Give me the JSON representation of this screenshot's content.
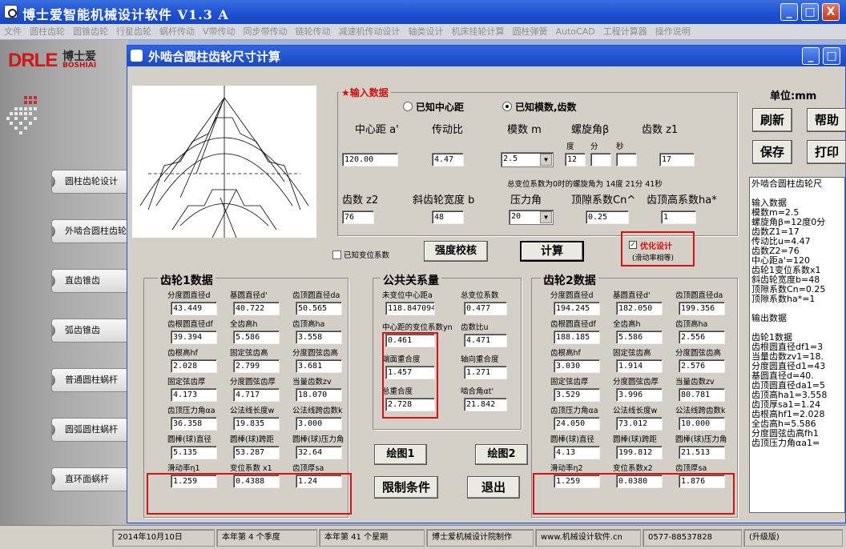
{
  "app": {
    "title": "博士爱智能机械设计软件 V1.3 A",
    "win_min": "_",
    "win_max": "□",
    "win_close": "X"
  },
  "menu": [
    "文件",
    "圆柱齿轮",
    "圆锥齿轮",
    "行星齿轮",
    "蜗杆传动",
    "V带传动",
    "同步带传动",
    "链轮传动",
    "减速机传动设计",
    "轴类设计",
    "机床挂轮计算",
    "圆柱弹簧",
    "AutoCAD",
    "工程计算器",
    "操作说明"
  ],
  "logo": {
    "brand": "DRLE",
    "cn": "博士爱",
    "en": "BOSHIAI"
  },
  "nav": [
    "圆柱齿轮设计",
    "外啮合圆柱齿轮",
    "直齿锥齿",
    "弧齿锥齿",
    "普通圆柱蜗杆",
    "圆弧圆柱蜗杆",
    "直环面蜗杆"
  ],
  "dialog": {
    "title": "外啮合圆柱齿轮尺寸计算"
  },
  "input": {
    "title": "★输入数据",
    "radio1": "已知中心距",
    "radio2": "已知模数,齿数",
    "l_center": "中心距 a'",
    "l_ratio": "传动比",
    "l_module": "模数 m",
    "l_helix": "螺旋角β",
    "l_z1": "齿数 z1",
    "deg": "度",
    "min": "分",
    "sec": "秒",
    "v_center": "120.00",
    "v_ratio": "4.47",
    "v_module": "2.5",
    "v_deg": "12",
    "v_min": "",
    "v_sec": "",
    "v_z1": "17",
    "note": "总变位系数为0时的螺旋角为 14度 21分 41秒",
    "l_z2": "齿数 z2",
    "l_width": "斜齿轮宽度 b",
    "l_press": "压力角",
    "l_cn": "顶隙系数Cn^",
    "l_ha": "齿顶高系数ha*",
    "v_z2": "76",
    "v_width": "48",
    "v_press": "20",
    "v_cn": "0.25",
    "v_ha": "1"
  },
  "right": {
    "unit": "单位:mm",
    "refresh": "刷新",
    "help": "帮助",
    "save": "保存",
    "print": "打印"
  },
  "btns": {
    "known_shift": "已知变位系数",
    "strength": "强度校核",
    "calc": "计算",
    "opt": "优化设计",
    "opt2": "(滑动率相等)",
    "draw1": "绘图1",
    "draw2": "绘图2",
    "limit": "限制条件",
    "exit": "退出"
  },
  "g1": {
    "title": "齿轮1数据",
    "r1": [
      "分度圆直径d",
      "基圆直径d'",
      "齿顶圆直径da"
    ],
    "v1": [
      "43.449",
      "40.722",
      "50.565"
    ],
    "r2": [
      "齿根圆直径df",
      "全齿高h",
      "齿顶高ha"
    ],
    "v2": [
      "39.394",
      "5.586",
      "3.558"
    ],
    "r3": [
      "齿根高hf",
      "固定弦齿高",
      "分度圆弦齿高"
    ],
    "v3": [
      "2.028",
      "2.799",
      "3.681"
    ],
    "r4": [
      "固定弦齿厚",
      "分度圆弦齿厚",
      "当量齿数zv"
    ],
    "v4": [
      "4.173",
      "4.717",
      "18.070"
    ],
    "r5": [
      "齿顶压力角αa",
      "公法线长度w",
      "公法线跨齿数k"
    ],
    "v5": [
      "36.358",
      "19.835",
      "3.000"
    ],
    "r6": [
      "圆棒(球)直径",
      "圆棒(球)跨距",
      "圆棒(球)压力角"
    ],
    "v6": [
      "5.135",
      "53.287",
      "32.64"
    ],
    "r7": [
      "滑动率η1",
      "变位系数 x1",
      "齿顶厚sa"
    ],
    "v7": [
      "1.259",
      "0.4388",
      "1.24"
    ]
  },
  "common": {
    "title": "公共关系量",
    "r1": [
      "未变位中心距a",
      "总变位系数"
    ],
    "v1": [
      "118.8470942",
      "0.477"
    ],
    "r2": [
      "中心距的变位系数yn",
      "齿数比u"
    ],
    "v2": [
      "0.461",
      "4.471"
    ],
    "r3": [
      "端面重合度",
      "轴向重合度"
    ],
    "v3": [
      "1.457",
      "1.271"
    ],
    "r4": [
      "总重合度",
      "啮合角αt'"
    ],
    "v4": [
      "2.728",
      "21.842"
    ]
  },
  "g2": {
    "title": "齿轮2数据",
    "r1": [
      "分度圆直径d",
      "基圆直径d'",
      "齿顶圆直径da"
    ],
    "v1": [
      "194.245",
      "182.050",
      "199.356"
    ],
    "r2": [
      "齿根圆直径df",
      "全齿高h",
      "齿顶高ha"
    ],
    "v2": [
      "188.185",
      "5.586",
      "2.556"
    ],
    "r3": [
      "齿根高hf",
      "固定弦齿高",
      "分度圆弦齿高"
    ],
    "v3": [
      "3.030",
      "1.914",
      "2.576"
    ],
    "r4": [
      "固定弦齿厚",
      "分度圆弦齿厚",
      "当量齿数zv"
    ],
    "v4": [
      "3.529",
      "3.996",
      "80.781"
    ],
    "r5": [
      "齿顶压力角αa",
      "公法线长度w",
      "公法线跨齿数k"
    ],
    "v5": [
      "24.050",
      "73.012",
      "10.000"
    ],
    "r6": [
      "圆棒(球)直径",
      "圆棒(球)跨距",
      "圆棒(球)压力角"
    ],
    "v6": [
      "4.13",
      "199.812",
      "21.513"
    ],
    "r7": [
      "滑动率η2",
      "变位系数x2",
      "齿顶厚sa"
    ],
    "v7": [
      "1.259",
      "0.0380",
      "1.876"
    ]
  },
  "output": [
    "外啮合圆柱齿轮尺",
    "",
    "输入数据",
    "模数m=2.5",
    "螺旋角β=12度0分",
    "齿数Z1=17",
    "传动比u=4.47",
    "齿数Z2=76",
    "中心距a'=120",
    "齿轮1变位系数x1",
    "斜齿轮宽度b=48",
    "顶隙系数Cn=0.25",
    "顶隙系数ha*=1",
    "",
    "输出数据",
    "",
    "齿轮1数据",
    "齿根圆直径df1=3",
    "当量齿数zv1=18.",
    "分度圆直径d1=43",
    "基圆直径d=40.",
    "齿顶圆直径da1=5",
    "齿顶高ha1=3.558",
    "齿顶厚sa1=1.24",
    "齿根高hf1=2.028",
    "全齿高h=5.586",
    "分度圆弦齿高fh1",
    "齿顶压力角αa1="
  ],
  "status": [
    "2014年10月10日",
    "本年第 4 个季度",
    "本年第 41 个星期",
    "博士爱机械设计院制作",
    "www.机械设计软件.cn",
    "0577-88537828",
    "(升级版)"
  ]
}
